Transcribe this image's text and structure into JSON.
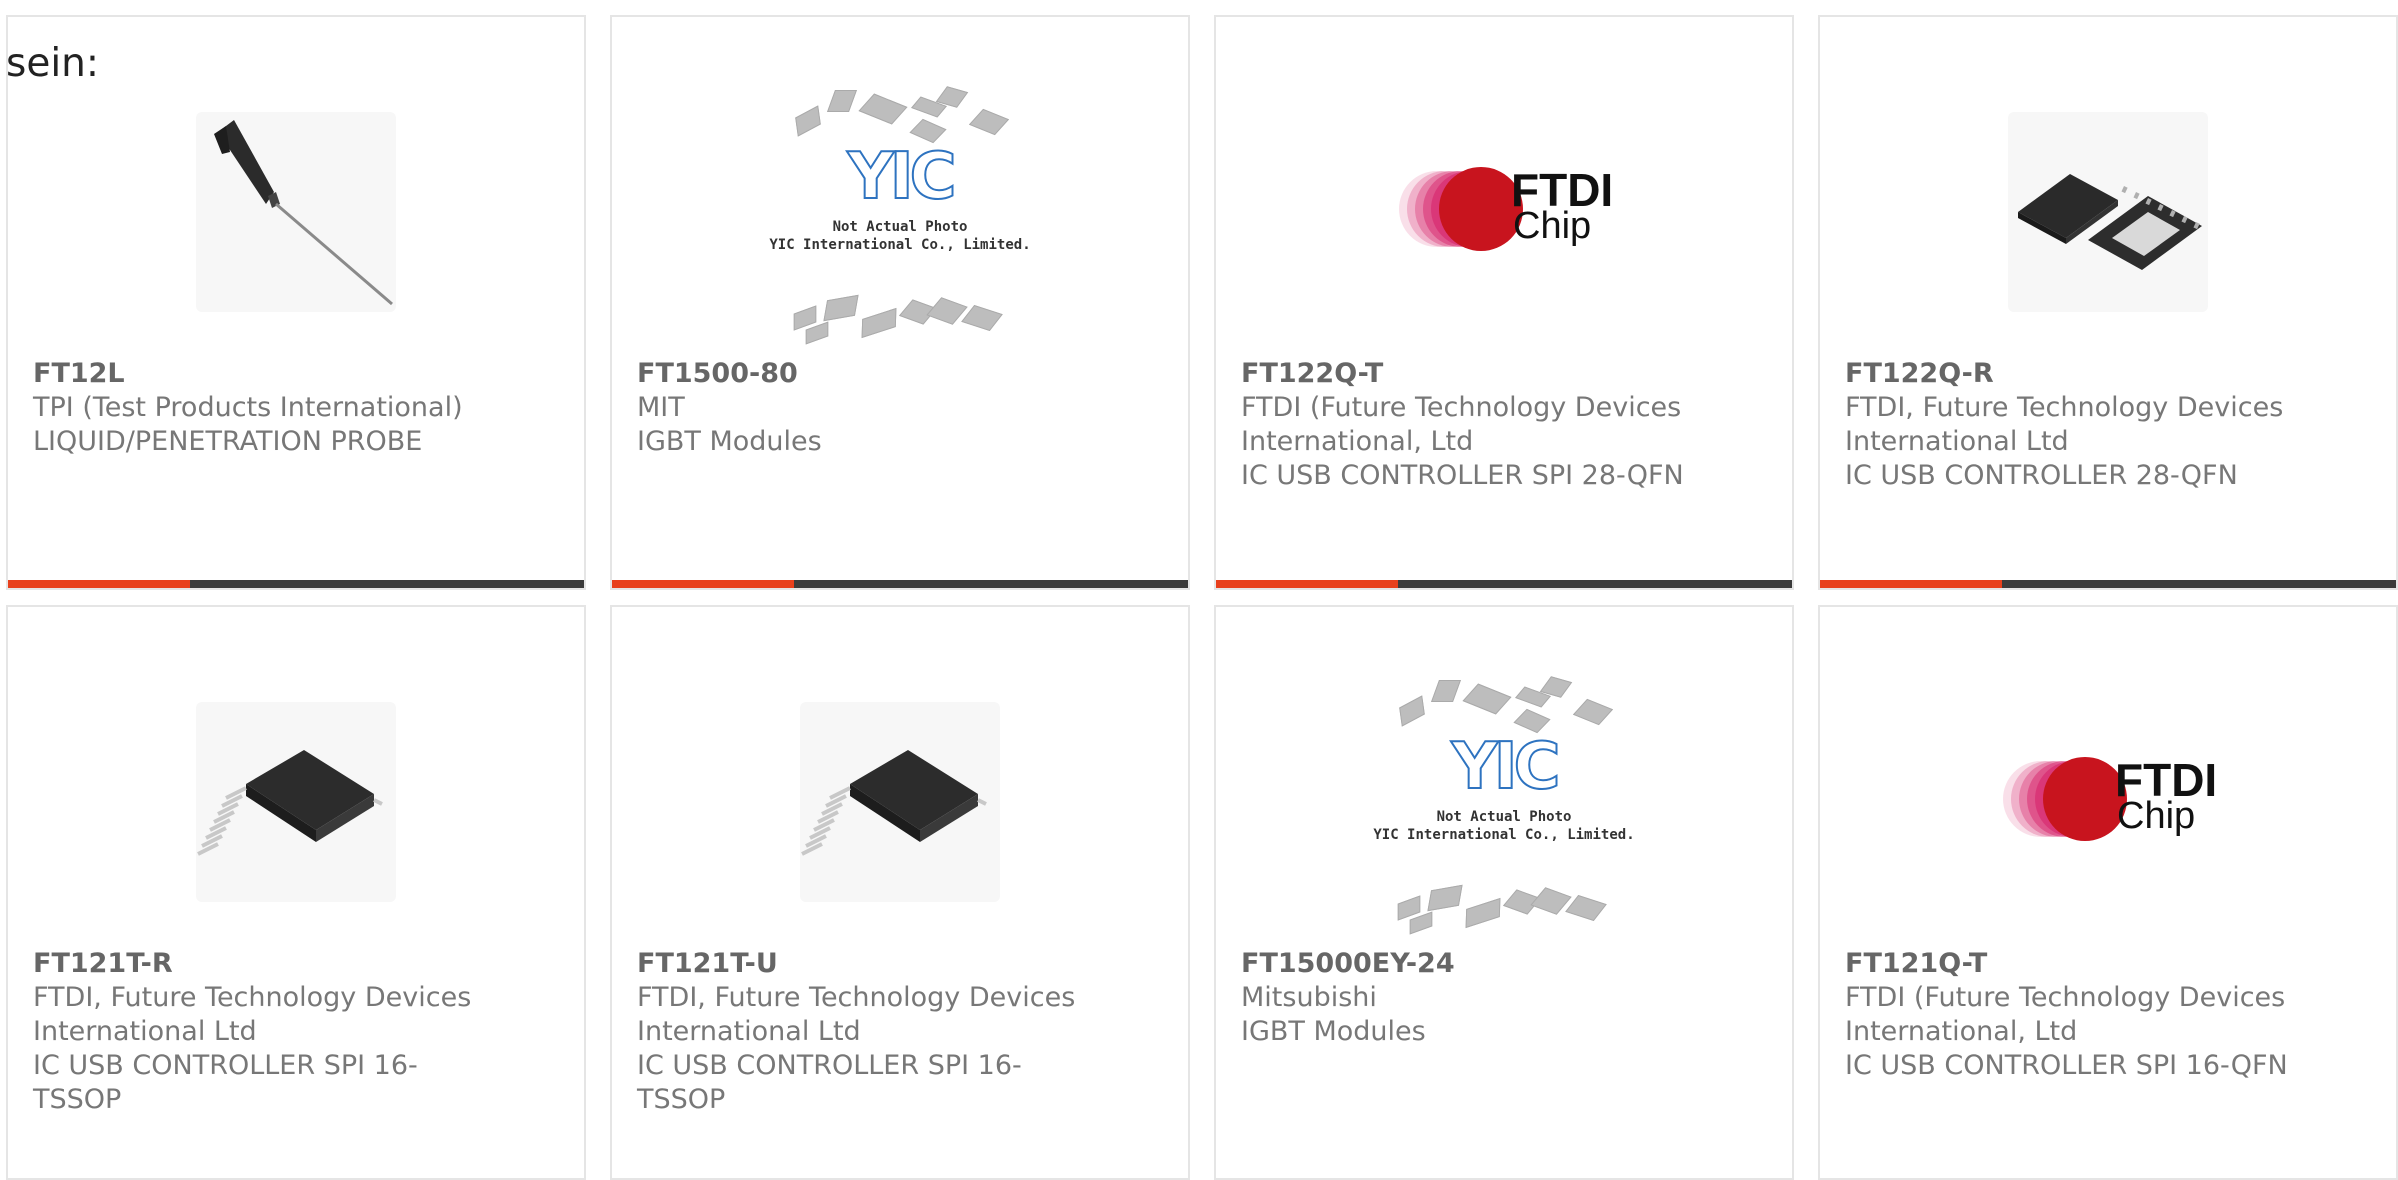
{
  "intro_text": "sein:",
  "products": [
    {
      "part": "FT12L",
      "manufacturer": "TPI (Test Products International)",
      "description": "LIQUID/PENETRATION PROBE",
      "image": "probe"
    },
    {
      "part": "FT1500-80",
      "manufacturer": "MIT",
      "description": "IGBT Modules",
      "image": "yic-placeholder"
    },
    {
      "part": "FT122Q-T",
      "manufacturer": "FTDI (Future Technology Devices International, Ltd",
      "description": "IC USB CONTROLLER SPI 28-QFN",
      "image": "ftdi-logo"
    },
    {
      "part": "FT122Q-R",
      "manufacturer": "FTDI, Future Technology Devices International Ltd",
      "description": "IC USB CONTROLLER 28-QFN",
      "image": "qfn-chip"
    },
    {
      "part": "FT121T-R",
      "manufacturer": "FTDI, Future Technology Devices International Ltd",
      "description": "IC USB CONTROLLER SPI 16-TSSOP",
      "image": "tssop-chip"
    },
    {
      "part": "FT121T-U",
      "manufacturer": "FTDI, Future Technology Devices International Ltd",
      "description": "IC USB CONTROLLER SPI 16-TSSOP",
      "image": "tssop-chip"
    },
    {
      "part": "FT15000EY-24",
      "manufacturer": "Mitsubishi",
      "description": "IGBT Modules",
      "image": "yic-placeholder"
    },
    {
      "part": "FT121Q-T",
      "manufacturer": "FTDI (Future Technology Devices International, Ltd",
      "description": "IC USB CONTROLLER SPI 16-QFN",
      "image": "ftdi-logo"
    }
  ],
  "artwork": {
    "yic_logo": "YIC",
    "yic_caption_line1": "Not Actual Photo",
    "yic_caption_line2": "YIC International Co., Limited.",
    "ftdi_logo_line1": "FTDI",
    "ftdi_logo_line2": "Chip"
  },
  "colors": {
    "accent": "#e8401c",
    "bar": "#3b3b3b",
    "border": "#e5e5e5",
    "text": "#777777"
  }
}
